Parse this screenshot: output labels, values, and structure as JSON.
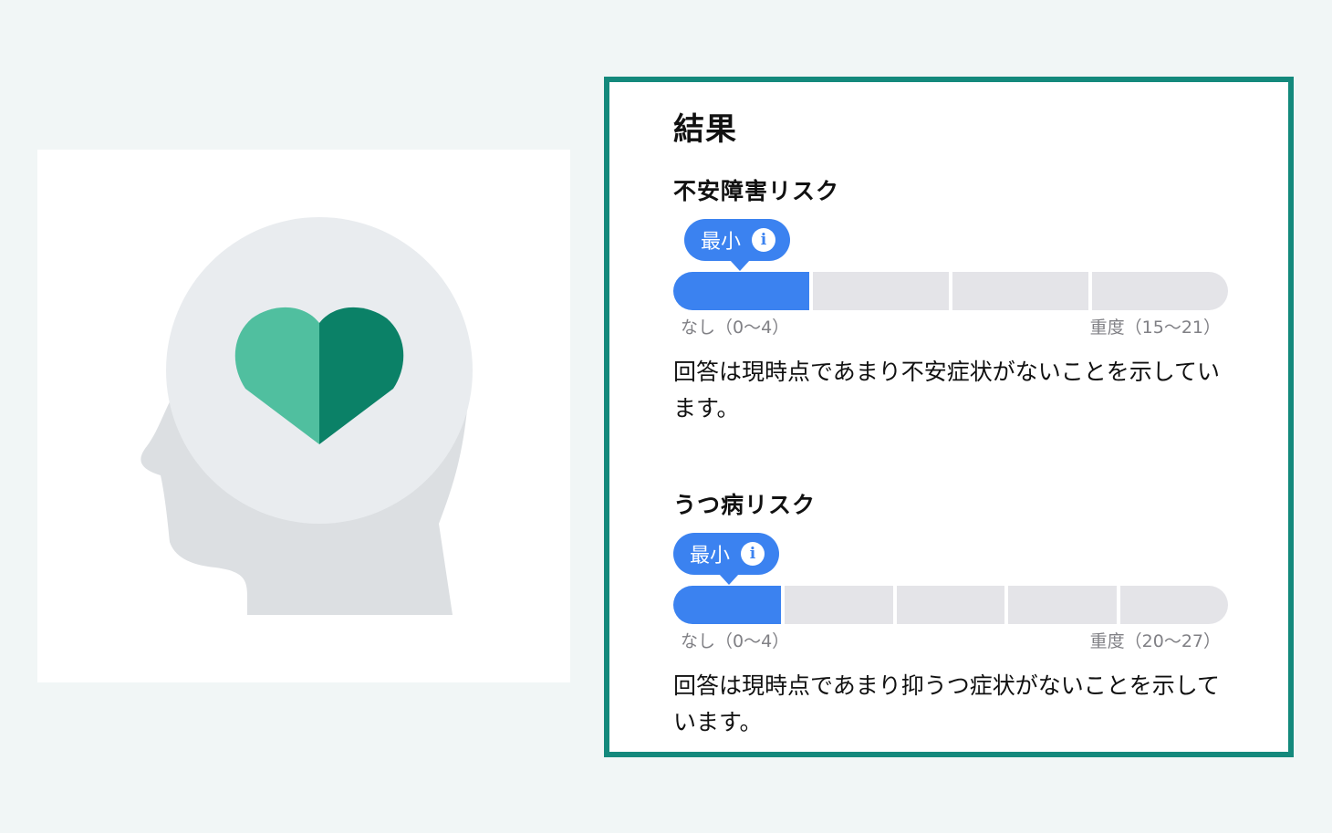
{
  "results": {
    "title": "結果",
    "anxiety": {
      "title": "不安障害リスク",
      "level_label": "最小",
      "segments": 4,
      "active_segments": 1,
      "min_label": "なし（0～4）",
      "max_label": "重度（15～21）",
      "description": "回答は現時点であまり不安症状がないことを示しています。"
    },
    "depression": {
      "title": "うつ病リスク",
      "level_label": "最小",
      "segments": 5,
      "active_segments": 1,
      "min_label": "なし（0～4）",
      "max_label": "重度（20～27）",
      "description": "回答は現時点であまり抑うつ症状がないことを示しています。"
    }
  },
  "icons": {
    "illustration": "head-heart-icon",
    "info": "info-icon"
  },
  "colors": {
    "accent_blue": "#3b82f0",
    "panel_border": "#14897c",
    "heart_light": "#50bf9f",
    "heart_dark": "#0b8167",
    "bar_empty": "#e4e4e8"
  }
}
